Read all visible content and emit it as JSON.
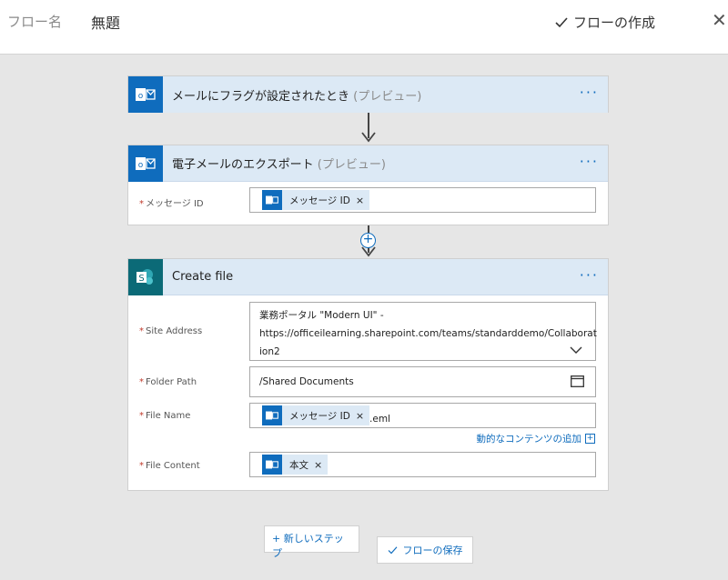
{
  "header": {
    "flow_name_label": "フロー名",
    "flow_name_value": "無題",
    "create_flow": "フローの作成",
    "close": "✕"
  },
  "step1": {
    "title": "メールにフラグが設定されたとき",
    "tag": "(プレビュー)",
    "icon": "outlook-icon"
  },
  "step2": {
    "title": "電子メールのエクスポート",
    "tag": "(プレビュー)",
    "icon": "outlook-icon",
    "fields": {
      "message_id_label": "メッセージ ID",
      "message_id_token": "メッセージ ID"
    }
  },
  "step3": {
    "title": "Create file",
    "icon": "sharepoint-icon",
    "fields": {
      "site_address_label": "Site Address",
      "site_address_line1": "業務ポータル \"Modern UI\" -",
      "site_address_line2": "https://officeilearning.sharepoint.com/teams/standarddemo/Collaborat",
      "site_address_line3": "ion2",
      "folder_path_label": "Folder Path",
      "folder_path_value": "/Shared Documents",
      "file_name_label": "File Name",
      "file_name_token": "メッセージ ID",
      "file_name_suffix": ".eml",
      "dynamic_content_link": "動的なコンテンツの追加",
      "file_content_label": "File Content",
      "file_content_token": "本文"
    }
  },
  "footer": {
    "new_step": "+ 新しいステップ",
    "save_flow": "フローの保存"
  },
  "colors": {
    "accent": "#0f6cbd",
    "header_bg": "#dce9f5",
    "sharepoint": "#0b6a77"
  }
}
